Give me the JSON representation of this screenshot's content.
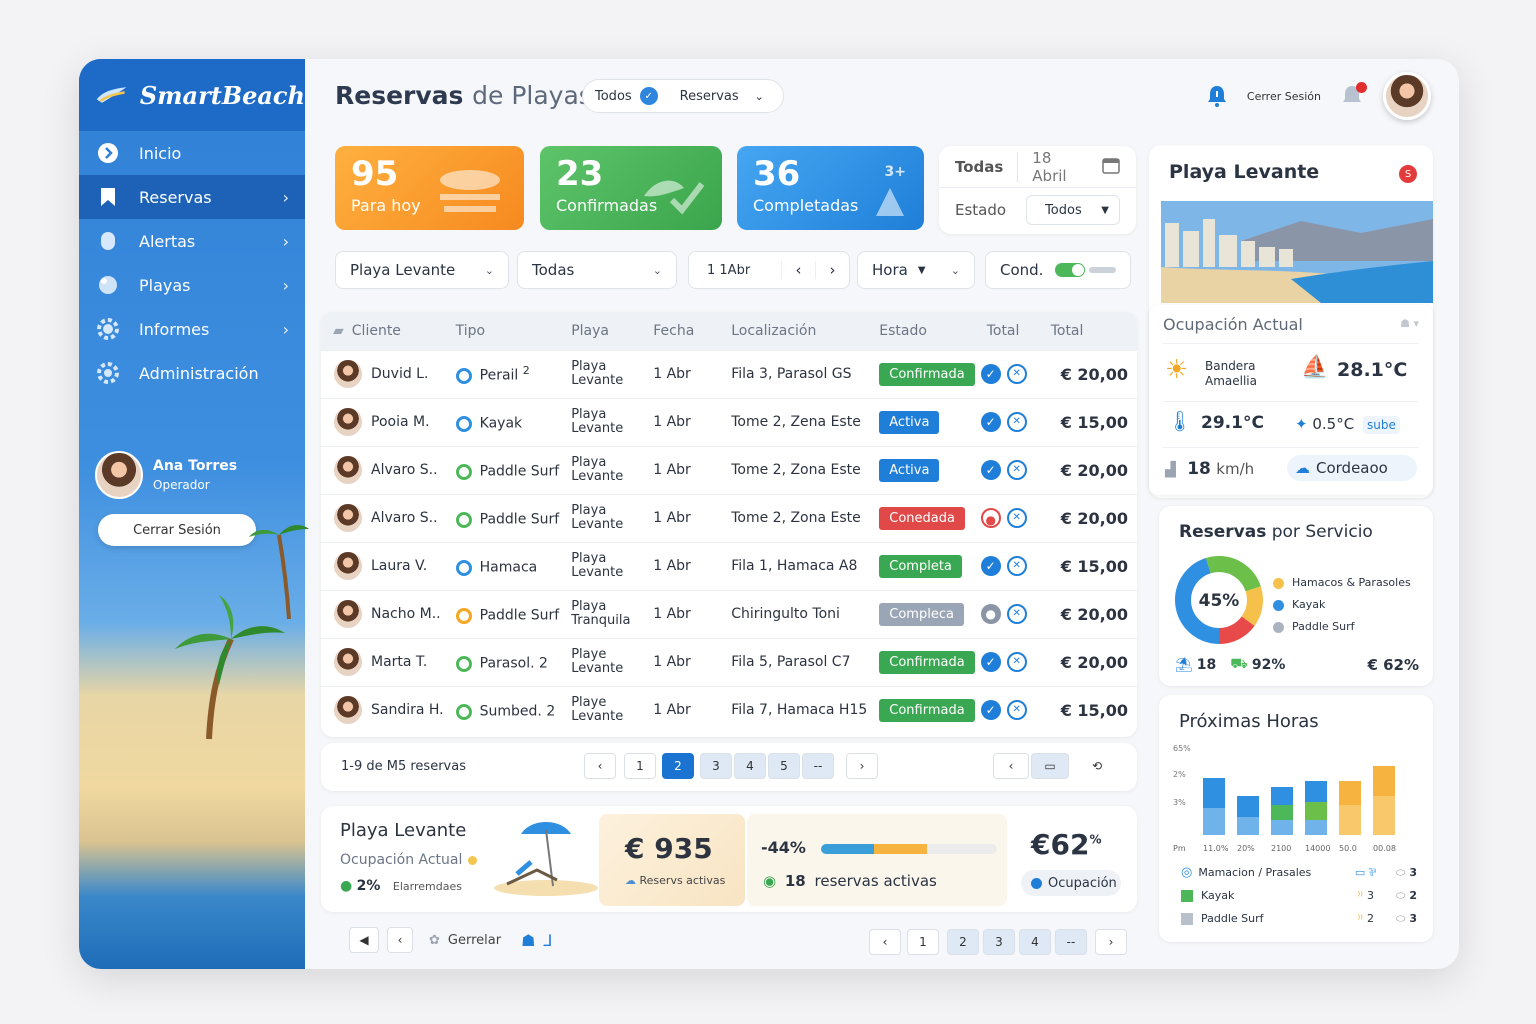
{
  "brand": {
    "name": "SmartBeach"
  },
  "sidebar": {
    "items": [
      {
        "label": "Inicio"
      },
      {
        "label": "Reservas"
      },
      {
        "label": "Alertas"
      },
      {
        "label": "Playas"
      },
      {
        "label": "Informes"
      },
      {
        "label": "Administración"
      }
    ],
    "user": {
      "name": "Ana Torres",
      "role": "Operador"
    },
    "logout_label": "Cerrar Sesión"
  },
  "header": {
    "title_main": "Reservas",
    "title_rest": "de Playas",
    "filter_left": "Todos",
    "filter_right": "Reservas",
    "session_label": "Cerrer Sesión"
  },
  "stats": [
    {
      "value": "95",
      "label": "Para hoy",
      "color": "#f7a430"
    },
    {
      "value": "23",
      "label": "Confirmadas",
      "color": "#4cb85a"
    },
    {
      "value": "36",
      "label": "Completadas",
      "color": "#2f8fe0"
    }
  ],
  "stat_badge": "3+",
  "date_filter": {
    "all_label": "Todas",
    "date": "18 Abril",
    "estado_label": "Estado",
    "estado_value": "Todos"
  },
  "filters": {
    "beach": "Playa Levante",
    "type": "Todas",
    "date": "1 1Abr",
    "time": "Hora",
    "cond": "Cond."
  },
  "table": {
    "headers": [
      "Cliente",
      "Tipo",
      "Playa",
      "Fecha",
      "Localización",
      "Estado",
      "Total",
      "Total"
    ],
    "rows": [
      {
        "client": "Duvid L.",
        "tipo": "Perail",
        "tipo_sup": "2",
        "playa1": "Playa",
        "playa2": "Levante",
        "fecha": "1 Abr",
        "loc": "Fila 3, Parasol GS",
        "estado": "Confirmada",
        "total": "€ 20,00"
      },
      {
        "client": "Pooia M.",
        "tipo": "Kayak",
        "tipo_sup": "",
        "playa1": "Playa",
        "playa2": "Levante",
        "fecha": "1 Abr",
        "loc": "Tome 2, Zena Este",
        "estado": "Activa",
        "total": "€ 15,00"
      },
      {
        "client": "Alvaro S..",
        "tipo": "Paddle Surf",
        "tipo_sup": "",
        "playa1": "Playa",
        "playa2": "Levante",
        "fecha": "1 Abr",
        "loc": "Tome 2, Zona Este",
        "estado": "Activa",
        "total": "€ 20,00"
      },
      {
        "client": "Alvaro S..",
        "tipo": "Paddle Surf",
        "tipo_sup": "",
        "playa1": "Playa",
        "playa2": "Levante",
        "fecha": "1 Abr",
        "loc": "Tome 2, Zona Este",
        "estado": "Conedada",
        "total": "€ 20,00"
      },
      {
        "client": "Laura V.",
        "tipo": "Hamaca",
        "tipo_sup": "",
        "playa1": "Playa",
        "playa2": "Levante",
        "fecha": "1 Abr",
        "loc": "Fila 1, Hamaca A8",
        "estado": "Completa",
        "total": "€ 15,00"
      },
      {
        "client": "Nacho M..",
        "tipo": "Paddle Surf",
        "tipo_sup": "",
        "playa1": "Playa",
        "playa2": "Tranquila",
        "fecha": "1 Abr",
        "loc": "Chiringulto Toni",
        "estado": "Compleca",
        "total": "€ 20,00"
      },
      {
        "client": "Marta T.",
        "tipo": "Parasol. 2",
        "tipo_sup": "",
        "playa1": "Playe",
        "playa2": "Levante",
        "fecha": "1 Abr",
        "loc": "Fila 5, Parasol C7",
        "estado": "Confirmada",
        "total": "€ 20,00"
      },
      {
        "client": "Sandira H.",
        "tipo": "Sumbed. 2",
        "tipo_sup": "",
        "playa1": "Playe",
        "playa2": "Levante",
        "fecha": "1 Abr",
        "loc": "Fila 7, Hamaca H15",
        "estado": "Confirmada",
        "total": "€ 15,00"
      }
    ]
  },
  "pager": {
    "info": "1-9 de M5 reservas",
    "pages": [
      "1",
      "2",
      "3",
      "4",
      "5",
      "--"
    ]
  },
  "summary": {
    "title": "Playa Levante",
    "subtitle": "Ocupación Actual",
    "pct": "2%",
    "pct_label": "Elarremdaes",
    "amount": "€ 935",
    "amount_label": "Reservs activas",
    "delta": "-44%",
    "progress": 0.6,
    "active": "18",
    "active_label": "reservas activas",
    "big": "€62",
    "big_sup": "%",
    "occ_label": "Ocupación"
  },
  "footer": {
    "gestionar": "Gerrelar",
    "pages": [
      "1",
      "2",
      "3",
      "4",
      "--"
    ]
  },
  "beach_card": {
    "title": "Playa Levante",
    "badge": "S",
    "occ_title": "Ocupación Actual",
    "flag_line1": "Bandera",
    "flag_line2": "Amaellia",
    "air_temp": "28.1°C",
    "water_temp": "29.1°C",
    "delta": "0.5°C",
    "delta_label": "sube",
    "wind": "18",
    "wind_unit": "km/h",
    "place": "Cordeaoo"
  },
  "service_card": {
    "title_main": "Reservas",
    "title_rest": "por Servicio",
    "donut_pct": "45%",
    "legend": [
      {
        "label": "Hamacos & Parasoles",
        "color": "#f6c14a"
      },
      {
        "label": "Kayak",
        "color": "#2f8fe0"
      },
      {
        "label": "Paddle Surf",
        "color": "#aab3bf"
      }
    ],
    "stat1": "18",
    "stat2": "92%",
    "stat3": "€ 62%"
  },
  "hours_card": {
    "title": "Próximas Horas",
    "y_ticks": [
      "65%",
      "2%",
      "3%"
    ],
    "x_ticks": [
      "Pm",
      "11.0%",
      "20%",
      "2100",
      "14000",
      "50.0",
      "00.08"
    ],
    "legend": [
      {
        "label": "Mamacion / Prasales",
        "c1": "3",
        "c2": "",
        "color": "#2f8fe0"
      },
      {
        "label": "Kayak",
        "c1": "3",
        "c2": "2",
        "color": "#4cb85a"
      },
      {
        "label": "Paddle Surf",
        "c1": "2",
        "c2": "3",
        "color": "#b8c0cc"
      }
    ]
  },
  "chart_data": {
    "type": "bar",
    "title": "Próximas Horas",
    "categories": [
      "11.0%",
      "20%",
      "2100",
      "14000",
      "50.0",
      "00.08"
    ],
    "series": [
      {
        "name": "Mamacion / Prasales",
        "values": [
          1,
          0.7,
          0.6,
          0.7,
          0.8,
          1
        ]
      },
      {
        "name": "Kayak",
        "values": [
          0,
          0,
          0.5,
          0.6,
          0.4,
          0
        ]
      },
      {
        "name": "Paddle Surf",
        "values": [
          0.9,
          0.6,
          0.5,
          0.5,
          0.6,
          1.3
        ]
      }
    ]
  }
}
